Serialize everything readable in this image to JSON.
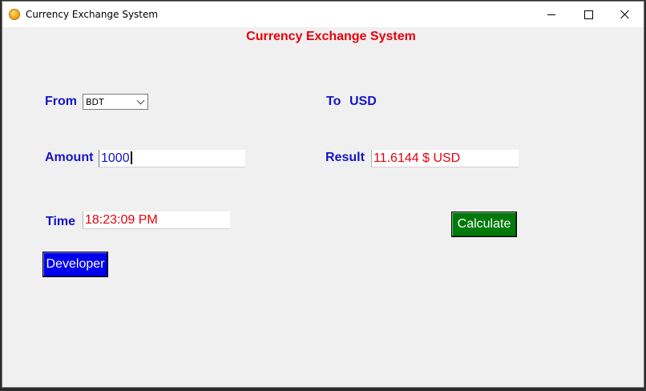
{
  "window": {
    "title": "Currency Exchange System"
  },
  "app": {
    "heading": "Currency Exchange System"
  },
  "form": {
    "from_label": "From",
    "from_value": "BDT",
    "to_label": "To",
    "to_value": "USD",
    "amount_label": "Amount",
    "amount_value": "1000",
    "result_label": "Result",
    "result_value": "11.6144  $ USD",
    "time_label": "Time",
    "time_value": "18:23:09 PM"
  },
  "buttons": {
    "calculate": "Calculate",
    "developer": "Developer"
  },
  "colors": {
    "heading": "#e8000b",
    "labels": "#1414c8",
    "calculate_bg": "#007a0a",
    "developer_bg": "#0000ee"
  }
}
